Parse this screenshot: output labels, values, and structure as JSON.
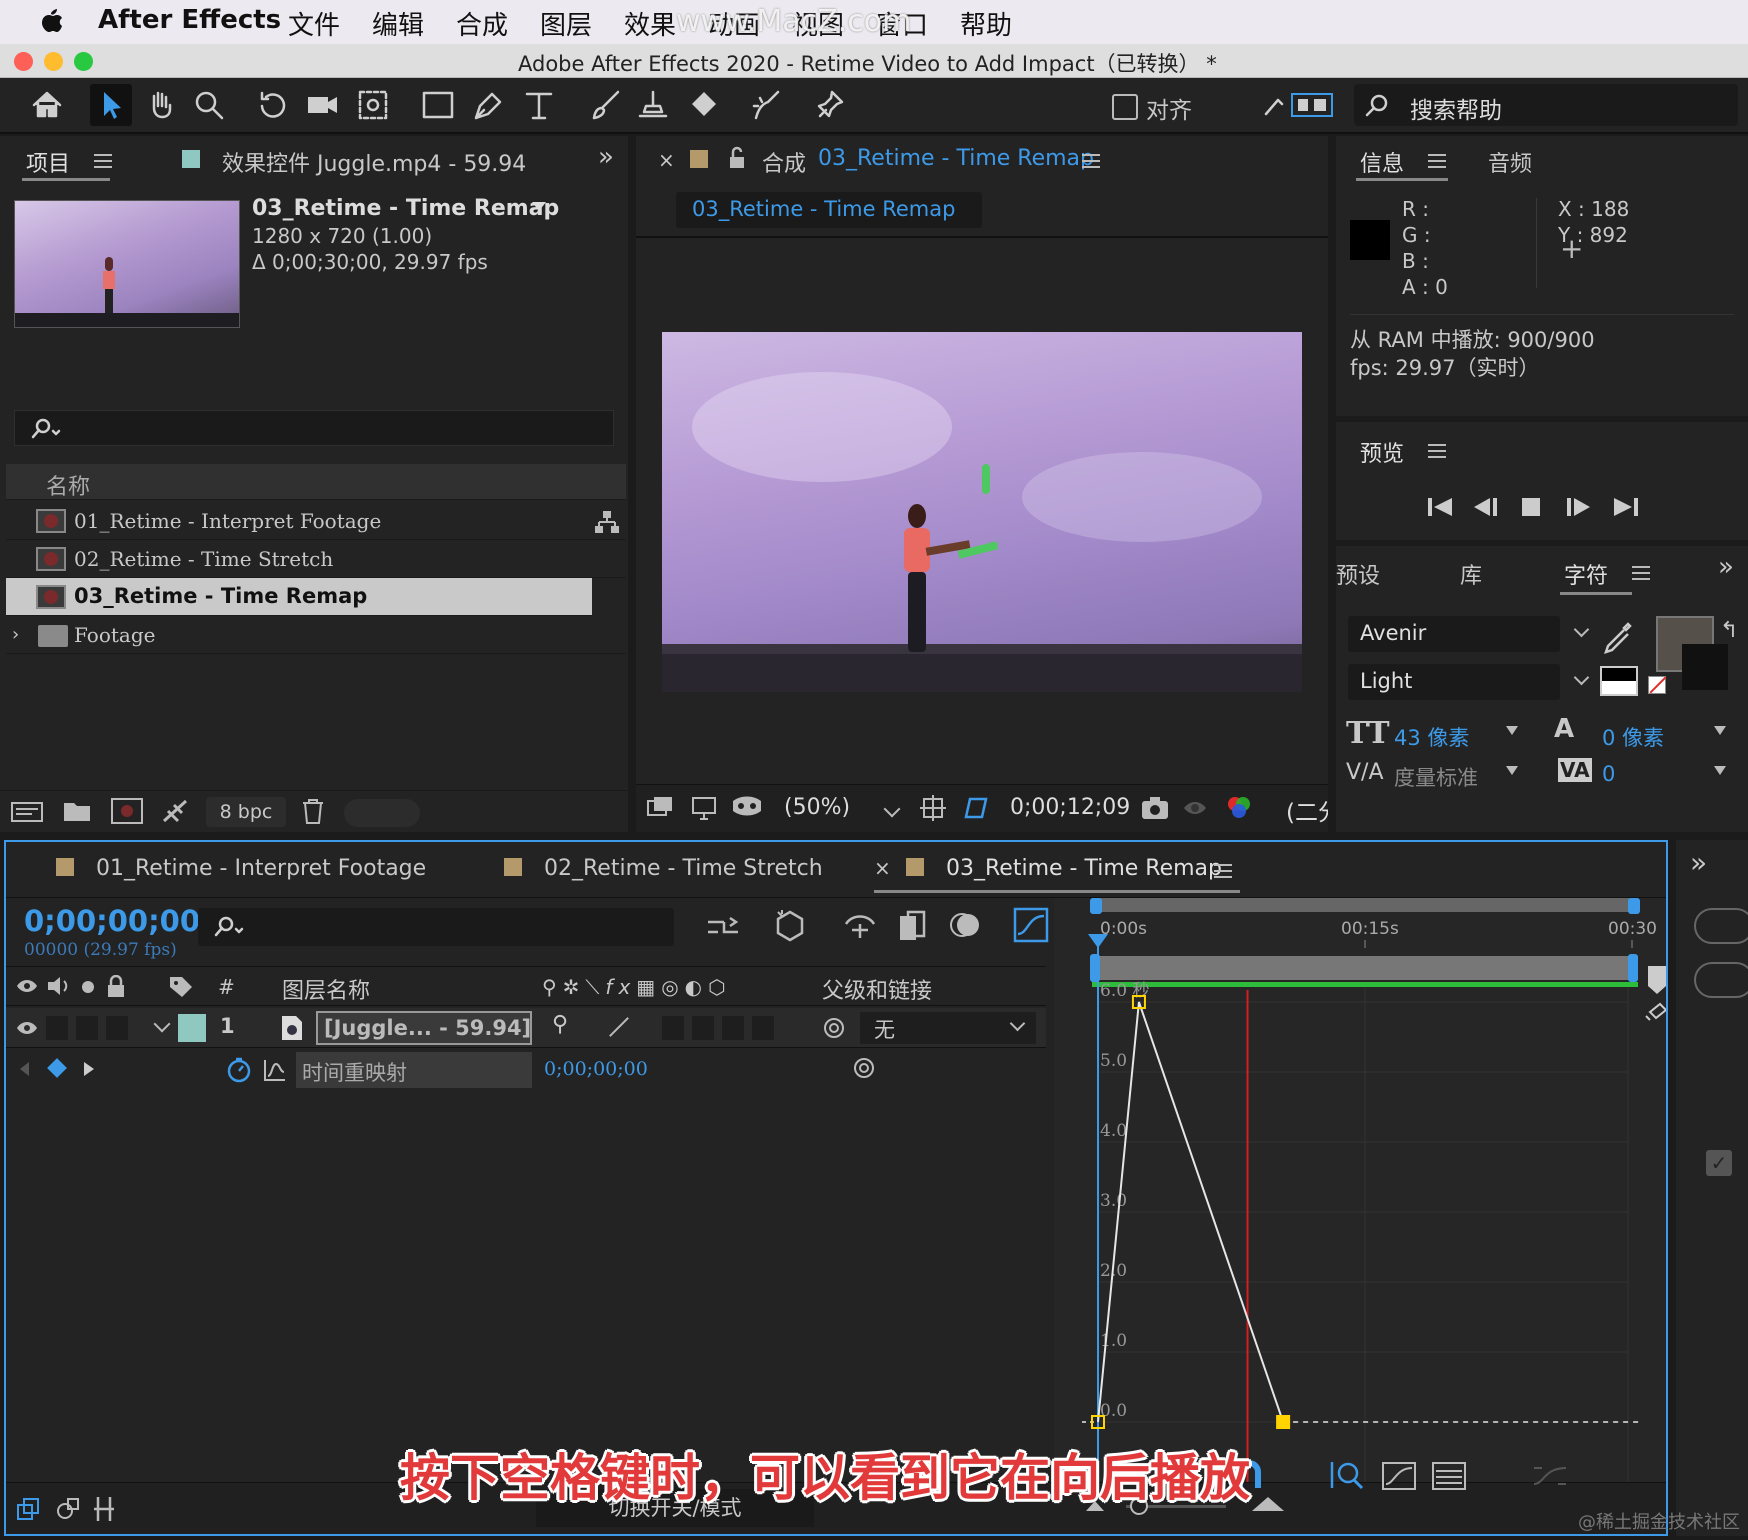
{
  "menubar": {
    "app": "After Effects",
    "items": [
      "文件",
      "编辑",
      "合成",
      "图层",
      "效果",
      "动画",
      "视图",
      "窗口",
      "帮助"
    ]
  },
  "watermark": "www.MacZ.com",
  "window": {
    "title": "Adobe After Effects 2020 - Retime Video to Add Impact（已转换） *"
  },
  "toolbar": {
    "snap_label": "对齐",
    "search_placeholder": "搜索帮助"
  },
  "project_panel": {
    "tab_project": "项目",
    "tab_effects": "效果控件 Juggle.mp4 - 59.94",
    "selected_name": "03_Retime - Time Remap",
    "dimensions": "1280 x 720 (1.00)",
    "duration": "Δ 0;00;30;00, 29.97 fps",
    "column_name": "名称",
    "items": [
      {
        "name": "01_Retime - Interpret Footage",
        "type": "comp"
      },
      {
        "name": "02_Retime - Time Stretch",
        "type": "comp"
      },
      {
        "name": "03_Retime - Time Remap",
        "type": "comp",
        "selected": true
      },
      {
        "name": "Footage",
        "type": "folder"
      }
    ],
    "bpc": "8 bpc"
  },
  "comp_panel": {
    "tab_prefix": "合成",
    "tab_name": "03_Retime - Time Remap",
    "sub_tab": "03_Retime - Time Remap",
    "zoom": "(50%)",
    "timecode": "0;00;12;09",
    "view_label": "(二分"
  },
  "info_panel": {
    "tab_info": "信息",
    "tab_audio": "音频",
    "r_label": "R :",
    "g_label": "G :",
    "b_label": "B :",
    "a_label": "A :",
    "a_value": "0",
    "x_label": "X :",
    "x_value": "188",
    "y_label": "Y :",
    "y_value": "892",
    "ram": "从 RAM 中播放: 900/900",
    "fps": "fps: 29.97（实时）"
  },
  "preview_panel": {
    "title": "预览"
  },
  "character_panel": {
    "tab_presets": "预设",
    "tab_library": "库",
    "tab_character": "字符",
    "font_family": "Avenir",
    "font_style": "Light",
    "font_size": "43 像素",
    "leading": "0 像素",
    "kerning": "度量标准",
    "tracking": "0"
  },
  "timeline": {
    "tabs": [
      "01_Retime - Interpret Footage",
      "02_Retime - Time Stretch",
      "03_Retime - Time Remap"
    ],
    "current_time": "0;00;00;00",
    "frame_info": "00000 (29.97 fps)",
    "col_layer_name": "图层名称",
    "col_parent": "父级和链接",
    "col_number": "#",
    "layer": {
      "number": "1",
      "name": "[Juggle... - 59.94]",
      "parent": "无"
    },
    "property": {
      "name": "时间重映射",
      "value": "0;00;00;00"
    },
    "switch_modes": "切换开关/模式",
    "ruler": [
      "0:00s",
      "00:15s",
      "00:30"
    ],
    "graph_labels": [
      "6.0 秒",
      "5.0",
      "4.0",
      "3.0",
      "2.0",
      "1.0",
      "0.0"
    ]
  },
  "graph_data": {
    "y_unit": "秒",
    "x_range_s": [
      0,
      30
    ],
    "y_range_s": [
      0,
      6
    ],
    "keyframes": [
      {
        "t": 0,
        "v": 0
      },
      {
        "t": 2.3,
        "v": 6.0
      },
      {
        "t": 10.4,
        "v": 0
      }
    ],
    "playhead_s": 8.4
  },
  "caption": "按下空格键时，可以看到它在向后播放",
  "corner_watermark": "@稀土掘金技术社区",
  "colors": {
    "accent_blue": "#3d9ae8",
    "layer_teal": "#8ec8c0",
    "caption_red": "#e23a3a",
    "green_bar": "#2dbd3a",
    "playhead_red": "#d02020"
  }
}
